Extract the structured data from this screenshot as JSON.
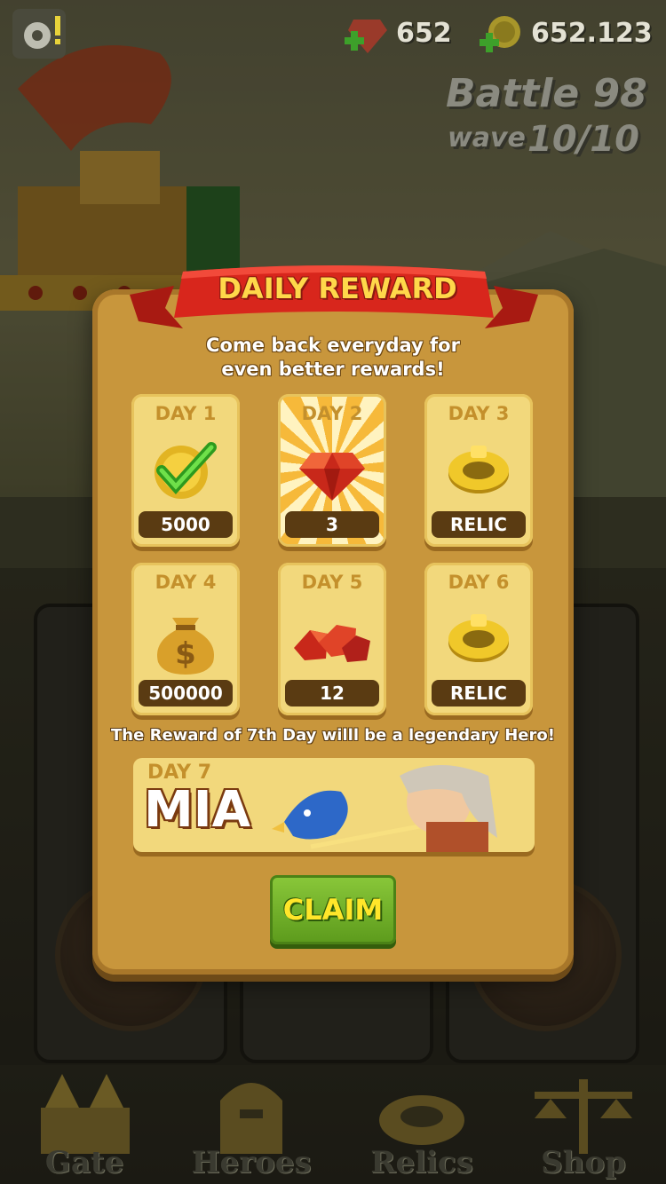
{
  "hud": {
    "gems": "652",
    "gold": "652.123",
    "battle": "Battle 98",
    "wave_label": "wave",
    "wave_value": "10/10"
  },
  "modal": {
    "title": "DAILY REWARD",
    "subtitle_line1": "Come back everyday for",
    "subtitle_line2": "even better rewards!",
    "rewards": [
      {
        "day": "DAY 1",
        "value": "5000",
        "icon": "coin-checked-icon"
      },
      {
        "day": "DAY 2",
        "value": "3",
        "icon": "gem-icon"
      },
      {
        "day": "DAY 3",
        "value": "RELIC",
        "icon": "relic-ring-icon"
      },
      {
        "day": "DAY 4",
        "value": "500000",
        "icon": "money-bag-icon"
      },
      {
        "day": "DAY 5",
        "value": "12",
        "icon": "gem-pile-icon"
      },
      {
        "day": "DAY 6",
        "value": "RELIC",
        "icon": "relic-ring-icon"
      }
    ],
    "legend_note": "The Reward of 7th Day willl be a legendary Hero!",
    "day7_label": "DAY 7",
    "day7_hero": "MIA",
    "claim": "CLAIM"
  },
  "nav": {
    "gate": "Gate",
    "heroes": "Heroes",
    "relics": "Relics",
    "shop": "Shop"
  },
  "colors": {
    "panel": "#c8963c",
    "card": "#f2d87c",
    "banner": "#d8261c",
    "title_yellow": "#ffd84a",
    "claim_green": "#6aaa24"
  }
}
